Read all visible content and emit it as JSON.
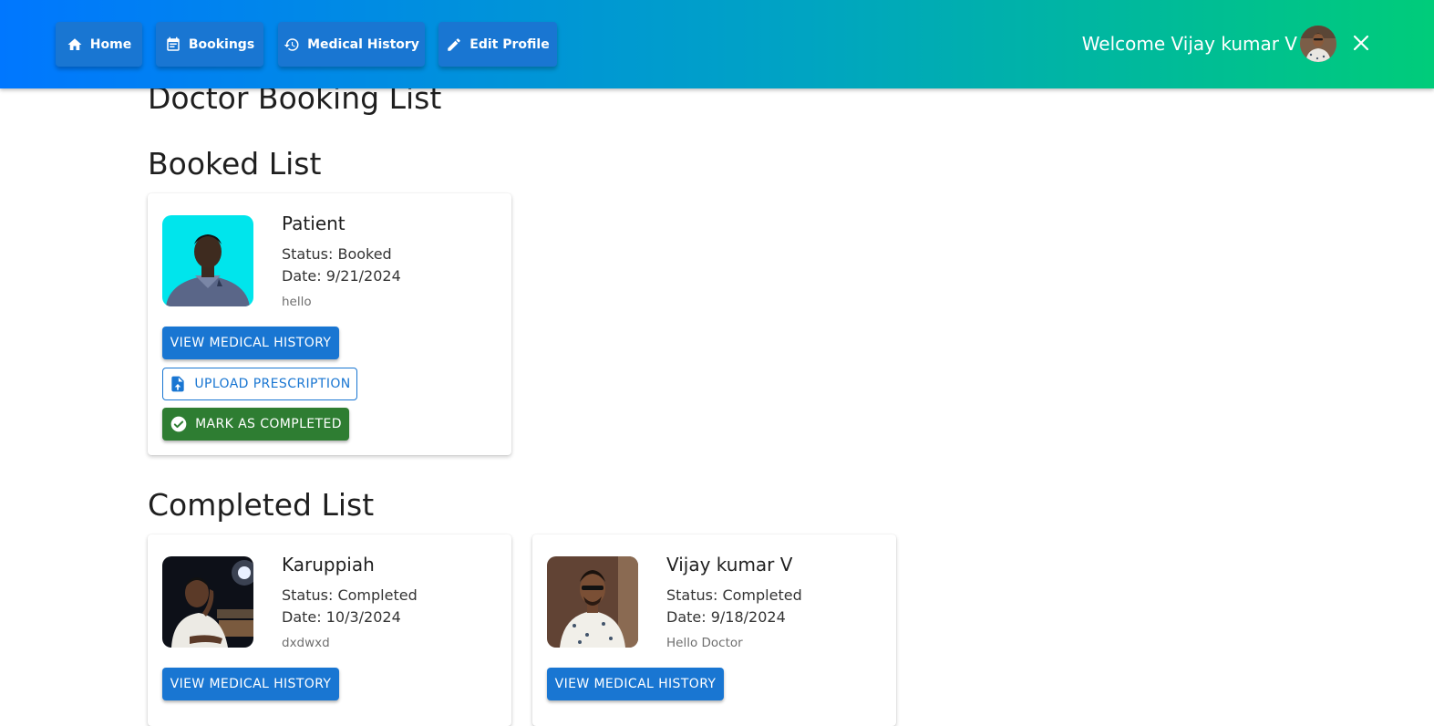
{
  "nav": {
    "home": "Home",
    "bookings": "Bookings",
    "medical_history": "Medical History",
    "edit_profile": "Edit Profile"
  },
  "header": {
    "welcome": "Welcome Vijay kumar V"
  },
  "page": {
    "title": "Doctor Booking List",
    "booked_heading": "Booked List",
    "completed_heading": "Completed List"
  },
  "booked": [
    {
      "name": "Patient",
      "status": "Status: Booked",
      "date": "Date: 9/21/2024",
      "note": "hello",
      "view_btn": "VIEW MEDICAL HISTORY",
      "upload_btn": "UPLOAD PRESCRIPTION",
      "complete_btn": "MARK AS COMPLETED"
    }
  ],
  "completed": [
    {
      "name": "Karuppiah",
      "status": "Status: Completed",
      "date": "Date: 10/3/2024",
      "note": "dxdwxd",
      "view_btn": "VIEW MEDICAL HISTORY"
    },
    {
      "name": "Vijay kumar V",
      "status": "Status: Completed",
      "date": "Date: 9/18/2024",
      "note": "Hello Doctor",
      "view_btn": "VIEW MEDICAL HISTORY"
    }
  ],
  "colors": {
    "primary": "#1976d2",
    "success": "#2e7d32",
    "gradient_start": "#0077ff",
    "gradient_end": "#00cc7a"
  }
}
